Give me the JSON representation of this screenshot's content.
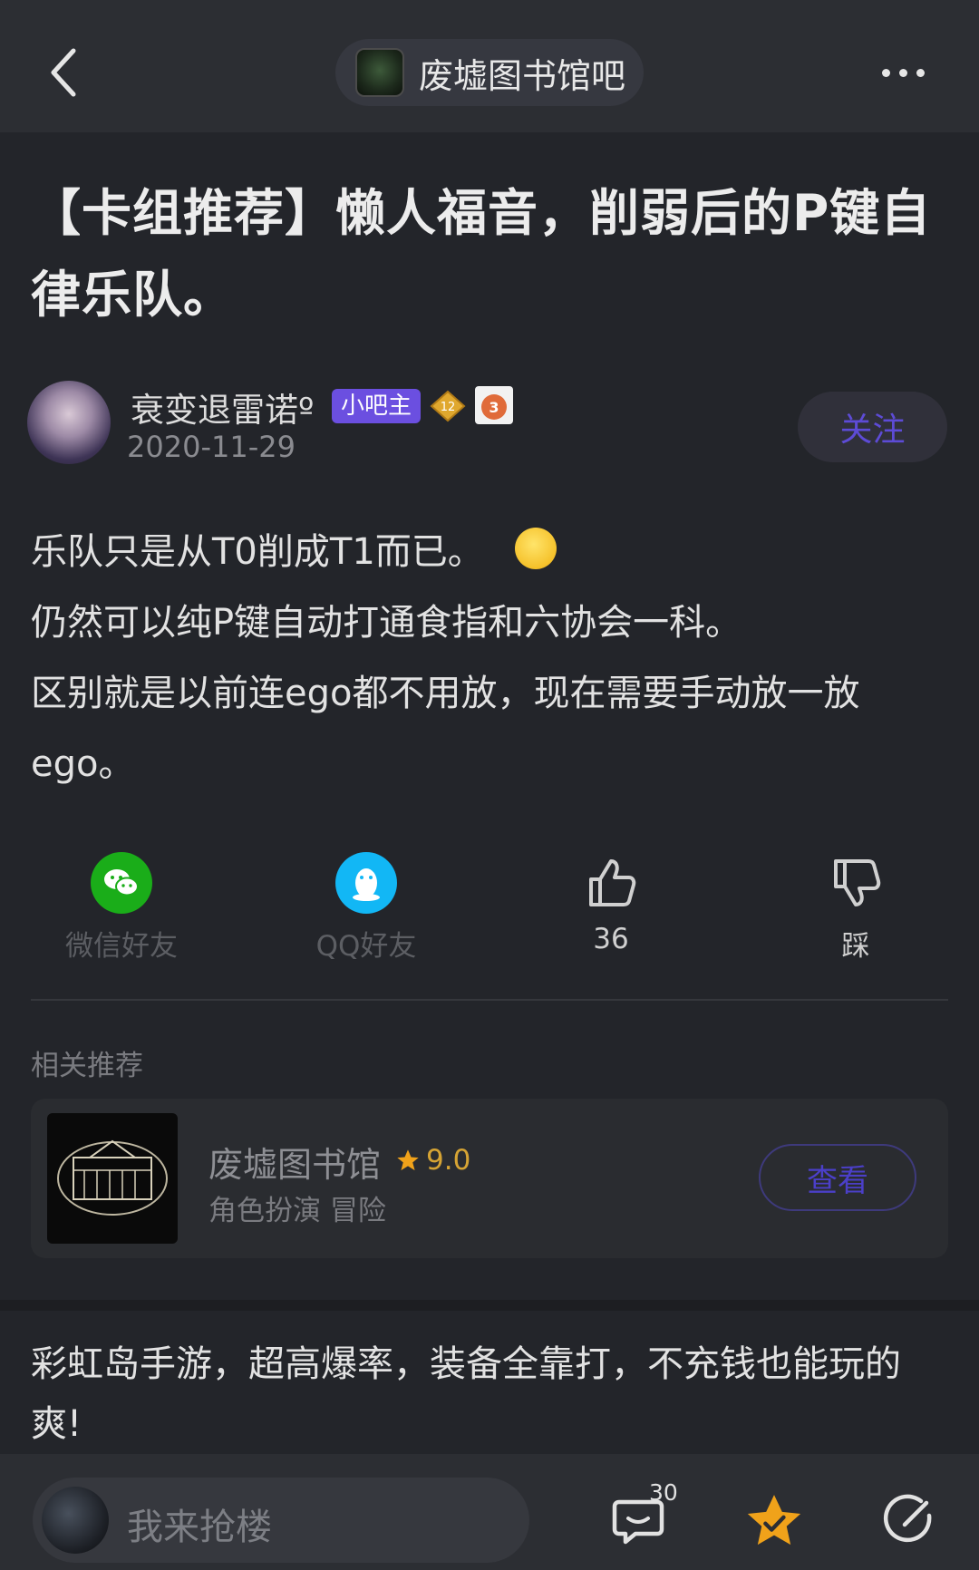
{
  "header": {
    "forum_name": "废墟图书馆吧"
  },
  "post": {
    "title": "【卡组推荐】懒人福音，削弱后的P键自律乐队。",
    "author": {
      "name": "衰变退雷诺º",
      "badge": "小吧主",
      "level": "12",
      "medal": "3",
      "date": "2020-11-29"
    },
    "follow_label": "关注",
    "paragraphs": [
      "乐队只是从T0削成T1而已。",
      "仍然可以纯P键自动打通食指和六协会一科。",
      "区别就是以前连ego都不用放，现在需要手动放一放ego。"
    ]
  },
  "actions": {
    "wechat": "微信好友",
    "qq": "QQ好友",
    "like_count": "36",
    "dislike": "踩"
  },
  "recommend": {
    "heading": "相关推荐",
    "game_name": "废墟图书馆",
    "rating": "9.0",
    "tags": "角色扮演 冒险",
    "view_label": "查看"
  },
  "ad": {
    "text": "彩虹岛手游，超高爆率，装备全靠打，不充钱也能玩的爽!"
  },
  "bottom": {
    "reply_placeholder": "我来抢楼",
    "comment_count": "30"
  },
  "icons": {
    "back": "chevron-left-icon",
    "more": "more-horizontal-icon",
    "wechat": "wechat-icon",
    "qq": "qq-penguin-icon",
    "like": "thumbs-up-icon",
    "dislike": "thumbs-down-icon",
    "star": "star-icon",
    "comment": "comment-bubble-icon",
    "favorite": "favorite-star-icon",
    "edit": "edit-pen-icon"
  },
  "colors": {
    "background": "#23252a",
    "accent": "#6b4fe0",
    "wechat": "#1aad19",
    "qq": "#12b7f5",
    "favorite": "#f0a21a",
    "rating": "#d6a434"
  }
}
